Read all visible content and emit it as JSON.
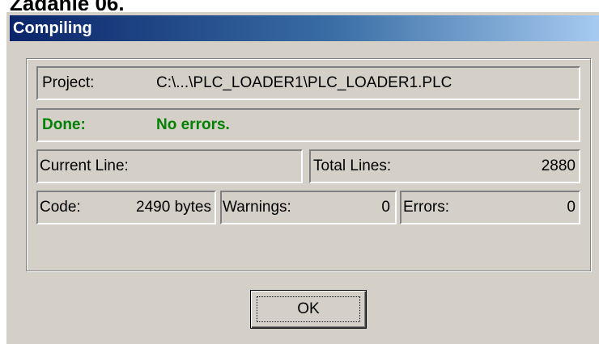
{
  "page_heading": "Zadanie 06.",
  "dialog": {
    "title": "Compiling",
    "project_label": "Project:",
    "project_value": "C:\\...\\PLC_LOADER1\\PLC_LOADER1.PLC",
    "status_label": "Done:",
    "status_value": "No errors.",
    "status_color": "#008000",
    "current_line_label": "Current Line:",
    "current_line_value": "",
    "total_lines_label": "Total Lines:",
    "total_lines_value": "2880",
    "code_label": "Code:",
    "code_value": "2490 bytes",
    "warnings_label": "Warnings:",
    "warnings_value": "0",
    "errors_label": "Errors:",
    "errors_value": "0",
    "ok_label": "OK"
  }
}
